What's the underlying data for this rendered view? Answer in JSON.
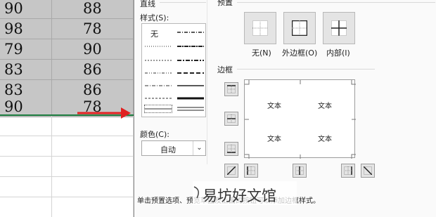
{
  "sheet": {
    "rows": [
      {
        "a": "90",
        "b": "88"
      },
      {
        "a": "98",
        "b": "78"
      },
      {
        "a": "79",
        "b": "90"
      },
      {
        "a": "83",
        "b": "86"
      },
      {
        "a": "83",
        "b": "86"
      },
      {
        "a": "90",
        "b": "78"
      }
    ]
  },
  "dialog": {
    "line_group": "直线",
    "style_label": "样式(S):",
    "style_none": "无",
    "color_label": "颜色(C):",
    "color_value": "自动",
    "presets_group": "预置",
    "presets": [
      {
        "label": "无(N)"
      },
      {
        "label": "外边框(O)"
      },
      {
        "label": "内部(I)"
      }
    ],
    "border_group": "边框",
    "preview_texts": [
      "文本",
      "文本",
      "文本",
      "文本"
    ],
    "hint": "单击预置选项、预览草图及上面的按钮可以添加边框样式。"
  },
  "watermark": "易坊好文馆",
  "colors": {
    "selection": "#c6c6c6",
    "arrow": "#e02020",
    "gridline_green": "#1a7a3c"
  }
}
